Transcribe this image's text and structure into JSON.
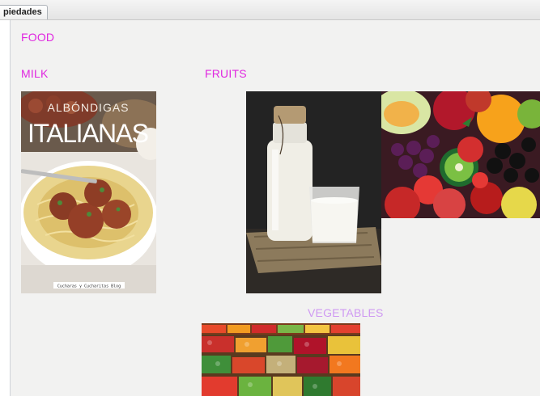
{
  "tab": {
    "label": "piedades"
  },
  "sections": {
    "food": "FOOD",
    "milk": "MILK",
    "fruits": "FRUITS",
    "vegetables": "VEGETABLES"
  },
  "images": {
    "recipe_cover": {
      "title_line1": "ALBÓNDIGAS",
      "title_line2": "ITALIANAS",
      "credit": "Cucharas y Cucharitas Blog"
    }
  },
  "colors": {
    "heading": "#e028e0",
    "heading_light": "#cf9af2",
    "panel_bg": "#f2f2f1"
  }
}
